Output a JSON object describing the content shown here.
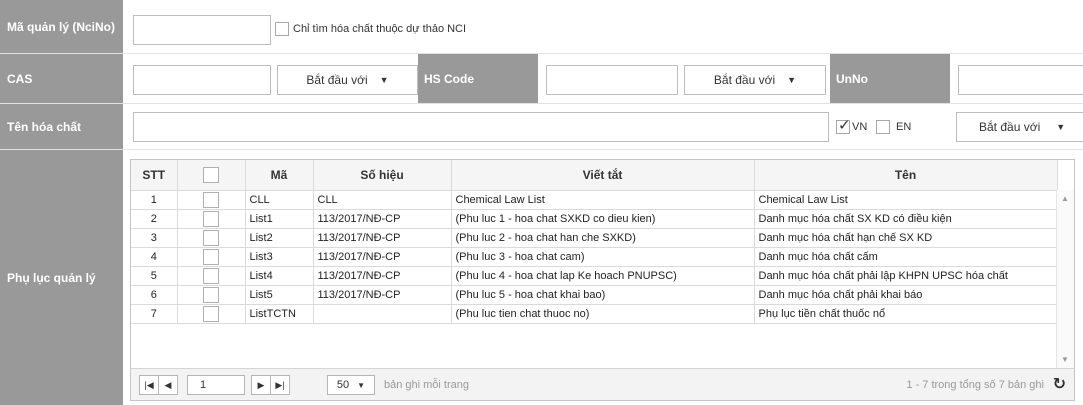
{
  "row_management_id": {
    "label": "Mã quản lý (NciNo)",
    "checkbox_label": "Chỉ tìm hóa chất thuộc dự thảo NCI"
  },
  "row_cas": {
    "label": "CAS",
    "match_select": "Bắt đầu với",
    "hs_label": "HS Code",
    "hs_select": "Bắt đầu với",
    "unno_label": "UnNo"
  },
  "row_name": {
    "label": "Tên hóa chất",
    "lang_vn": "VN",
    "lang_en": "EN",
    "match_select": "Bắt đầu với"
  },
  "row_appendix": {
    "label": "Phụ lục quản lý"
  },
  "grid": {
    "columns": [
      "STT",
      "",
      "Mã",
      "Số hiệu",
      "Viết tắt",
      "Tên"
    ],
    "rows": [
      {
        "stt": "1",
        "ma": "CLL",
        "so_hieu": "CLL",
        "viet_tat": "Chemical Law List",
        "ten": "Chemical Law List"
      },
      {
        "stt": "2",
        "ma": "List1",
        "so_hieu": "113/2017/NĐ-CP",
        "viet_tat": "(Phu luc 1 - hoa chat SXKD co dieu kien)",
        "ten": "Danh mục hóa chất SX KD có điều kiện"
      },
      {
        "stt": "3",
        "ma": "List2",
        "so_hieu": "113/2017/NĐ-CP",
        "viet_tat": "(Phu luc 2 - hoa chat han che SXKD)",
        "ten": "Danh mục hóa chất hạn chế SX KD"
      },
      {
        "stt": "4",
        "ma": "List3",
        "so_hieu": "113/2017/NĐ-CP",
        "viet_tat": "(Phu luc 3 - hoa chat cam)",
        "ten": "Danh mục hóa chất cấm"
      },
      {
        "stt": "5",
        "ma": "List4",
        "so_hieu": "113/2017/NĐ-CP",
        "viet_tat": "(Phu luc 4 - hoa chat lap Ke hoach PNUPSC)",
        "ten": "Danh mục hóa chất phải lập KHPN UPSC hóa chất"
      },
      {
        "stt": "6",
        "ma": "List5",
        "so_hieu": "113/2017/NĐ-CP",
        "viet_tat": "(Phu luc 5 - hoa chat khai bao)",
        "ten": "Danh mục hóa chất phải khai báo"
      },
      {
        "stt": "7",
        "ma": "ListTCTN",
        "so_hieu": "",
        "viet_tat": "(Phu luc tien chat thuoc no)",
        "ten": "Phụ lục tiền chất thuốc nổ"
      }
    ]
  },
  "pager": {
    "page": "1",
    "page_size": "50",
    "per_page_label": "bản ghi mỗi trang",
    "summary": "1 - 7 trong tổng số 7 bản ghi"
  },
  "icons": {
    "first": "first-page-icon",
    "prev": "prev-page-icon",
    "next": "next-page-icon",
    "last": "last-page-icon",
    "refresh": "refresh-icon"
  }
}
